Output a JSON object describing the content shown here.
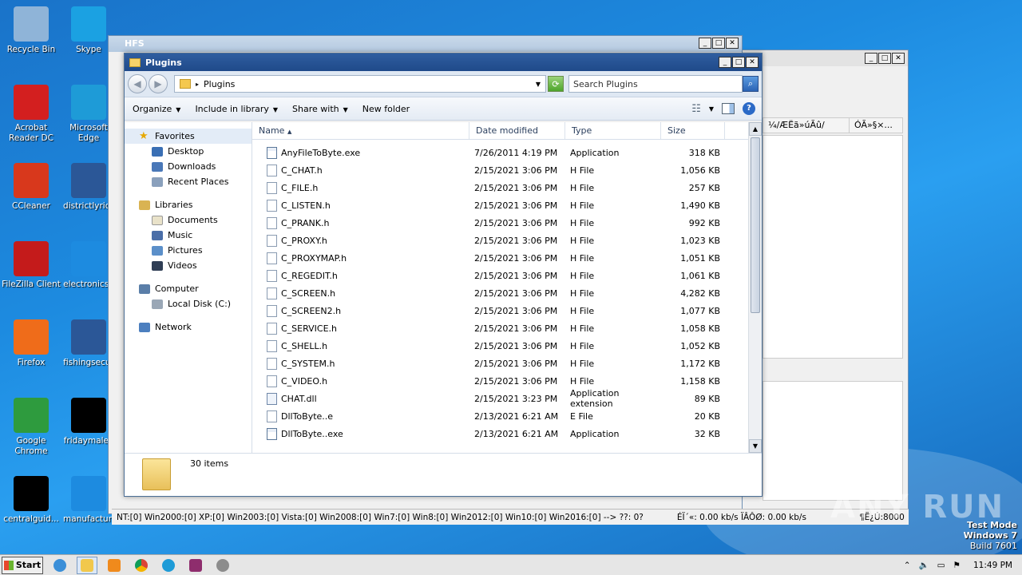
{
  "desktop": {
    "icons": [
      {
        "label": "Recycle Bin",
        "icon": "recycle-bin-icon",
        "color": "#8fb4d8"
      },
      {
        "label": "Skype",
        "icon": "skype-icon",
        "color": "#1ba1e2"
      },
      {
        "label": "Acrobat Reader DC",
        "icon": "acrobat-icon",
        "color": "#d31f1f"
      },
      {
        "label": "Microsoft Edge",
        "icon": "edge-icon",
        "color": "#1e9bd7"
      },
      {
        "label": "CCleaner",
        "icon": "ccleaner-icon",
        "color": "#d8381c"
      },
      {
        "label": "districtlyrics",
        "icon": "word-doc-icon",
        "color": "#2b5797"
      },
      {
        "label": "FileZilla Client",
        "icon": "filezilla-icon",
        "color": "#c41b1b"
      },
      {
        "label": "electronicsp",
        "icon": "blank-icon",
        "color": "#1d8be0"
      },
      {
        "label": "Firefox",
        "icon": "firefox-icon",
        "color": "#ef6c1a"
      },
      {
        "label": "fishingsecur",
        "icon": "word-doc-icon",
        "color": "#2b5797"
      },
      {
        "label": "Google Chrome",
        "icon": "chrome-icon",
        "color": "#2e9b3e"
      },
      {
        "label": "fridaymale.j",
        "icon": "black-file-icon",
        "color": "#000000"
      },
      {
        "label": "centralguid...",
        "icon": "black-file-icon",
        "color": "#000000"
      },
      {
        "label": "manufacturi",
        "icon": "blank-icon",
        "color": "#1d8be0"
      }
    ]
  },
  "hfs_window": {
    "title": "HFS",
    "header_cols": [
      "¼/ÆËã»úÃû/±¸×¢",
      "ÓÃ»§×..."
    ],
    "status": [
      "NT:[0] Win2000:[0] XP:[0] Win2003:[0] Vista:[0] Win2008:[0] Win7:[0] Win8:[0] Win2012:[0] Win10:[0] Win2016:[0] --> ??: 0?",
      "ÉÏ´«: 0.00 kb/s  ÏÂÔØ: 0.00 kb/s",
      "¶Ë¿Ú:8000"
    ]
  },
  "explorer": {
    "title": "Plugins",
    "address": "Plugins",
    "search_placeholder": "Search Plugins",
    "toolbar": {
      "organize": "Organize",
      "include": "Include in library",
      "share": "Share with",
      "new_folder": "New folder"
    },
    "nav": {
      "favorites": "Favorites",
      "desktop": "Desktop",
      "downloads": "Downloads",
      "recent": "Recent Places",
      "libraries": "Libraries",
      "documents": "Documents",
      "music": "Music",
      "pictures": "Pictures",
      "videos": "Videos",
      "computer": "Computer",
      "local_disk": "Local Disk (C:)",
      "network": "Network"
    },
    "columns": {
      "name": "Name",
      "date": "Date modified",
      "type": "Type",
      "size": "Size"
    },
    "files": [
      {
        "name": "AnyFileToByte.exe",
        "date": "7/26/2011 4:19 PM",
        "type": "Application",
        "size": "318 KB",
        "kind": "exe"
      },
      {
        "name": "C_CHAT.h",
        "date": "2/15/2021 3:06 PM",
        "type": "H File",
        "size": "1,056 KB",
        "kind": "h"
      },
      {
        "name": "C_FILE.h",
        "date": "2/15/2021 3:06 PM",
        "type": "H File",
        "size": "257 KB",
        "kind": "h"
      },
      {
        "name": "C_LISTEN.h",
        "date": "2/15/2021 3:06 PM",
        "type": "H File",
        "size": "1,490 KB",
        "kind": "h"
      },
      {
        "name": "C_PRANK.h",
        "date": "2/15/2021 3:06 PM",
        "type": "H File",
        "size": "992 KB",
        "kind": "h"
      },
      {
        "name": "C_PROXY.h",
        "date": "2/15/2021 3:06 PM",
        "type": "H File",
        "size": "1,023 KB",
        "kind": "h"
      },
      {
        "name": "C_PROXYMAP.h",
        "date": "2/15/2021 3:06 PM",
        "type": "H File",
        "size": "1,051 KB",
        "kind": "h"
      },
      {
        "name": "C_REGEDIT.h",
        "date": "2/15/2021 3:06 PM",
        "type": "H File",
        "size": "1,061 KB",
        "kind": "h"
      },
      {
        "name": "C_SCREEN.h",
        "date": "2/15/2021 3:06 PM",
        "type": "H File",
        "size": "4,282 KB",
        "kind": "h"
      },
      {
        "name": "C_SCREEN2.h",
        "date": "2/15/2021 3:06 PM",
        "type": "H File",
        "size": "1,077 KB",
        "kind": "h"
      },
      {
        "name": "C_SERVICE.h",
        "date": "2/15/2021 3:06 PM",
        "type": "H File",
        "size": "1,058 KB",
        "kind": "h"
      },
      {
        "name": "C_SHELL.h",
        "date": "2/15/2021 3:06 PM",
        "type": "H File",
        "size": "1,052 KB",
        "kind": "h"
      },
      {
        "name": "C_SYSTEM.h",
        "date": "2/15/2021 3:06 PM",
        "type": "H File",
        "size": "1,172 KB",
        "kind": "h"
      },
      {
        "name": "C_VIDEO.h",
        "date": "2/15/2021 3:06 PM",
        "type": "H File",
        "size": "1,158 KB",
        "kind": "h"
      },
      {
        "name": "CHAT.dll",
        "date": "2/15/2021 3:23 PM",
        "type": "Application extension",
        "size": "89 KB",
        "kind": "dll"
      },
      {
        "name": "DllToByte..e",
        "date": "2/13/2021 6:21 AM",
        "type": "E File",
        "size": "20 KB",
        "kind": "h"
      },
      {
        "name": "DllToByte..exe",
        "date": "2/13/2021 6:21 AM",
        "type": "Application",
        "size": "32 KB",
        "kind": "exe"
      }
    ],
    "item_count": "30 items"
  },
  "taskbar": {
    "start": "Start",
    "clock": "11:49 PM"
  },
  "watermark": {
    "line1": "Test Mode",
    "line2": "Windows 7",
    "line3": "Build 7601",
    "brand": "ANY RUN"
  }
}
